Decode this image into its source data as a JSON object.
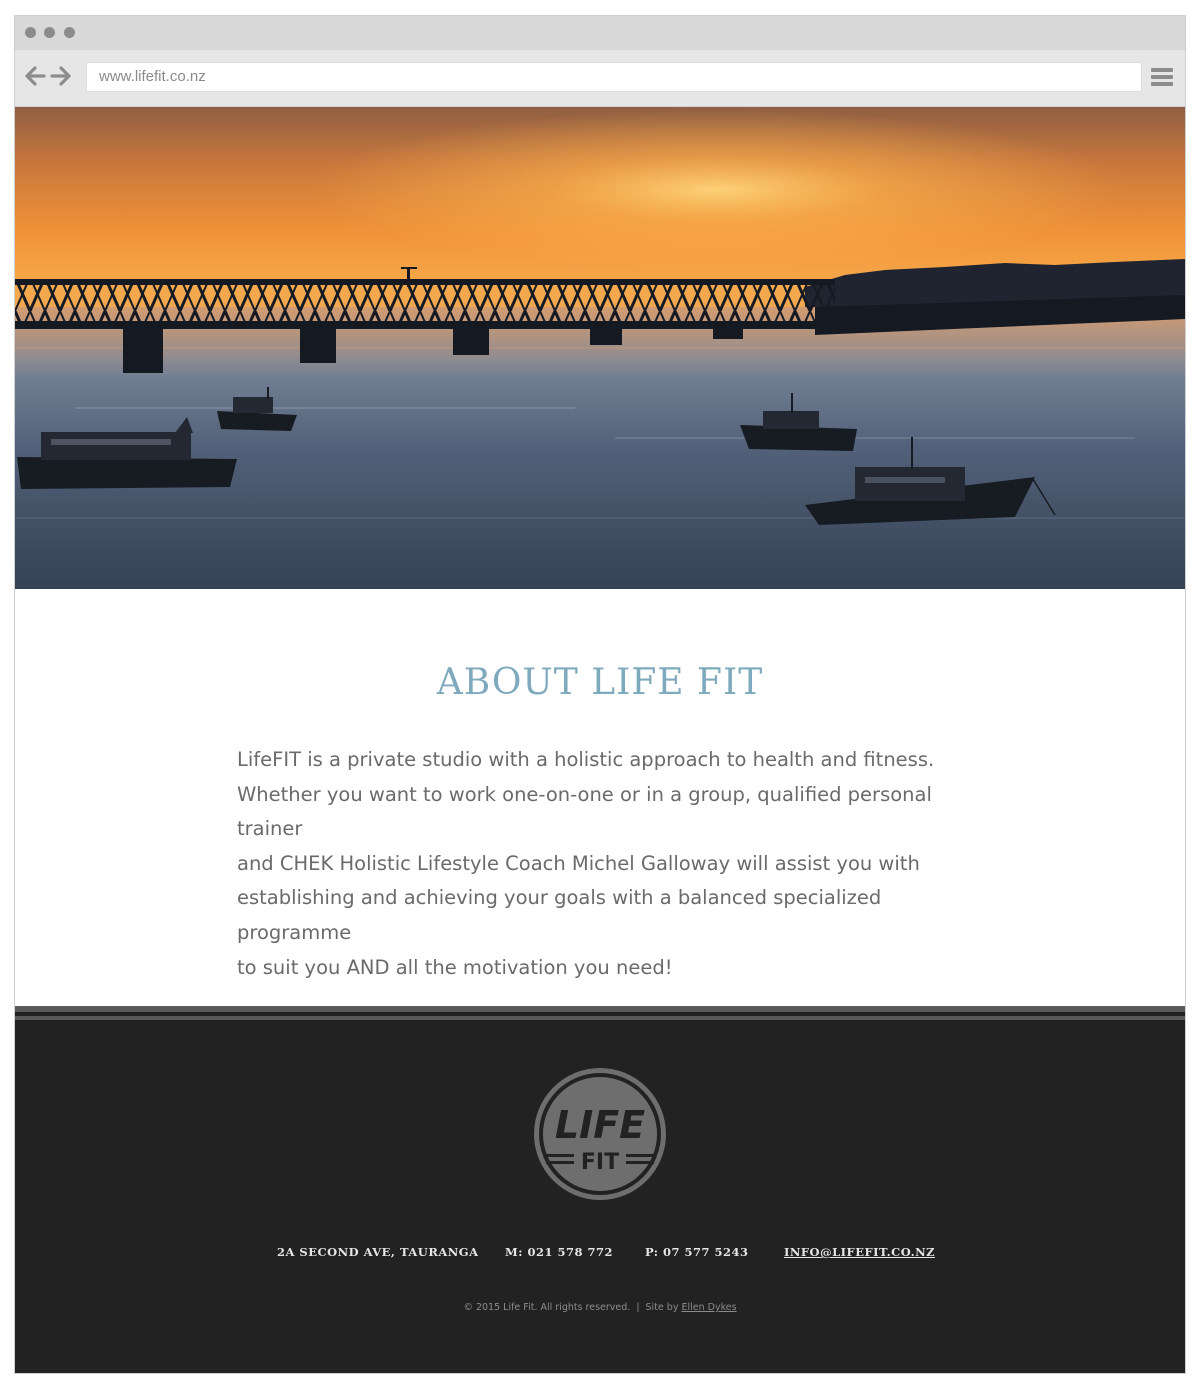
{
  "browser": {
    "url": "www.lifefit.co.nz",
    "icons": {
      "back": "arrow-left-icon",
      "forward": "arrow-right-icon",
      "menu": "hamburger-menu-icon"
    }
  },
  "about": {
    "title": "ABOUT LIFE FIT",
    "body_lines": [
      "LifeFIT is a private studio with a holistic approach to health and fitness.",
      "Whether you want to work one-on-one or in a group, qualified personal trainer",
      "and CHEK Holistic Lifestyle Coach Michel Galloway will assist you with",
      "establishing and achieving your goals with a balanced specialized programme",
      "to suit you AND all the motivation you need!"
    ]
  },
  "footer": {
    "logo": {
      "top_word": "LIFE",
      "bottom_word": "FIT"
    },
    "address": "2A SECOND AVE, TAURANGA",
    "mobile": "M: 021 578 772",
    "phone": "P: 07 577 5243",
    "email": "INFO@LIFEFIT.CO.NZ",
    "copyright": "© 2015 Life Fit. All rights reserved.",
    "separator": "|",
    "credit_prefix": "Site by",
    "credit_name": "Ellen Dykes"
  },
  "colors": {
    "title_accent": "#7fa9bd",
    "footer_bg": "#222222",
    "body_text": "#6a6a6a"
  }
}
